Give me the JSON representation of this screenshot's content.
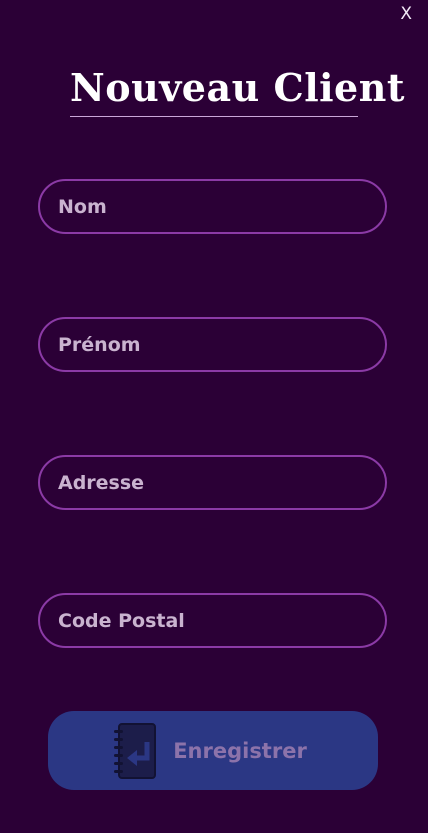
{
  "window": {
    "close_label": "X"
  },
  "form": {
    "title": "Nouveau Client",
    "fields": [
      {
        "placeholder": "Nom",
        "value": ""
      },
      {
        "placeholder": "Prénom",
        "value": ""
      },
      {
        "placeholder": "Adresse",
        "value": ""
      },
      {
        "placeholder": "Code Postal",
        "value": ""
      }
    ],
    "submit_label": "Enregistrer",
    "submit_icon": "notebook-enter-icon"
  },
  "colors": {
    "background": "#2b0036",
    "field_border": "#8b3aa6",
    "button_bg": "#2b3784",
    "button_text": "#8c73aa"
  }
}
